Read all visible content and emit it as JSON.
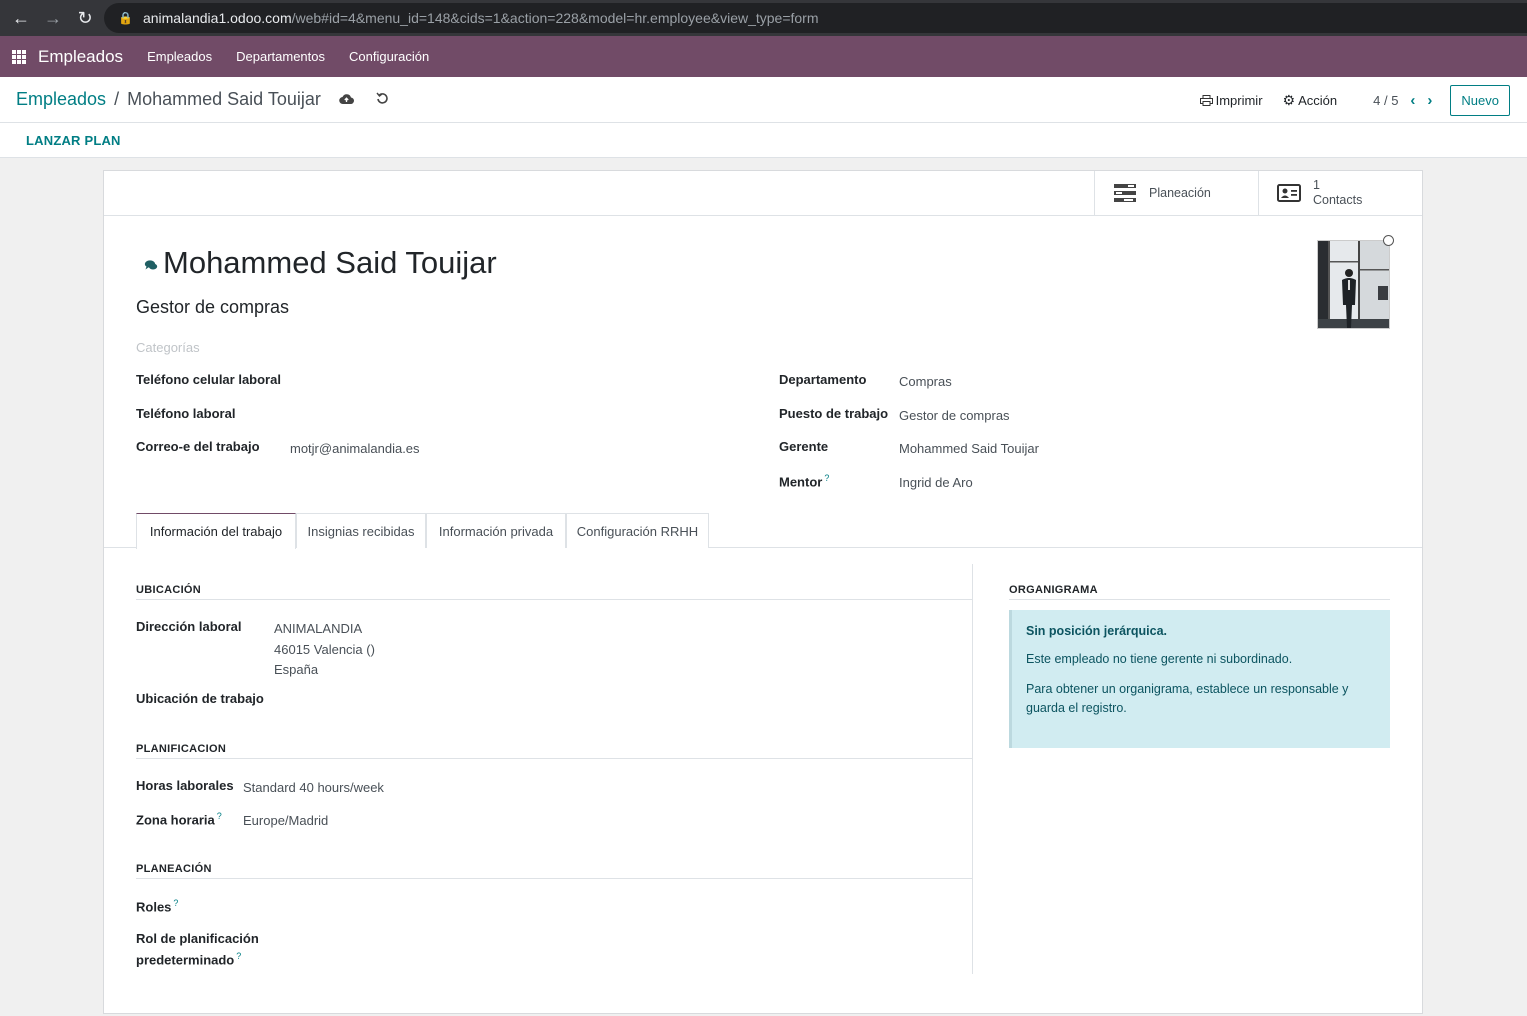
{
  "browser": {
    "url_host": "animalandia1.odoo.com",
    "url_path": "/web#id=4&menu_id=148&cids=1&action=228&model=hr.employee&view_type=form"
  },
  "navbar": {
    "app_name": "Empleados",
    "menu": [
      "Empleados",
      "Departamentos",
      "Configuración"
    ]
  },
  "control": {
    "breadcrumb_root": "Empleados",
    "breadcrumb_sep": "/",
    "breadcrumb_current": "Mohammed Said Touijar",
    "print_label": "Imprimir",
    "action_label": "Acción",
    "pager": "4 / 5",
    "new_label": "Nuevo",
    "launch_plan": "LANZAR PLAN"
  },
  "smart_buttons": {
    "planning_label": "Planeación",
    "contacts_count": "1",
    "contacts_label": "Contacts"
  },
  "employee": {
    "name": "Mohammed Said Touijar",
    "job_title": "Gestor de compras",
    "categories_placeholder": "Categorías"
  },
  "left_fields": [
    {
      "label": "Teléfono celular laboral",
      "value": ""
    },
    {
      "label": "Teléfono laboral",
      "value": ""
    },
    {
      "label": "Correo-e del trabajo",
      "value": "motjr@animalandia.es"
    }
  ],
  "right_fields": [
    {
      "label": "Departamento",
      "value": "Compras"
    },
    {
      "label": "Puesto de trabajo",
      "value": "Gestor de compras"
    },
    {
      "label": "Gerente",
      "value": "Mohammed Said Touijar"
    },
    {
      "label": "Mentor",
      "value": "Ingrid de Aro",
      "help": "?"
    }
  ],
  "tabs": [
    "Información del trabajo",
    "Insignias recibidas",
    "Información privada",
    "Configuración RRHH"
  ],
  "work_info": {
    "location_title": "UBICACIÓN",
    "work_address_label": "Dirección laboral",
    "work_address": [
      "ANIMALANDIA",
      "46015 Valencia ()",
      "España"
    ],
    "work_location_label": "Ubicación de trabajo",
    "planning_section_title": "PLANIFICACION",
    "hours_label": "Horas laborales",
    "hours_value": "Standard 40 hours/week",
    "tz_label": "Zona horaria",
    "tz_value": "Europe/Madrid",
    "planeacion_title": "PLANEACIÓN",
    "roles_label": "Roles",
    "default_role_label_1": "Rol de planificación",
    "default_role_label_2": "predeterminado",
    "help_mark": "?"
  },
  "org_chart": {
    "title": "ORGANIGRAMA",
    "line1": "Sin posición jerárquica.",
    "line2": "Este empleado no tiene gerente ni subordinado.",
    "line3": "Para obtener un organigrama, establece un responsable y guarda el registro."
  },
  "colors": {
    "brand": "#714b67",
    "accent": "#017e84",
    "info_bg": "#d1ecf1"
  }
}
